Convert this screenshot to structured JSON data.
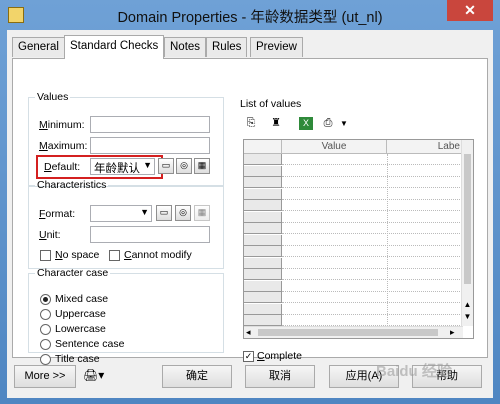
{
  "window": {
    "title": "Domain Properties - 年龄数据类型 (ut_nl)",
    "close": "✕"
  },
  "tabs": [
    {
      "label": "General"
    },
    {
      "label": "Standard Checks"
    },
    {
      "label": "Notes"
    },
    {
      "label": "Rules"
    },
    {
      "label": "Preview"
    }
  ],
  "values": {
    "legend": "Values",
    "minimum_label_ul": "M",
    "minimum_label": "inimum:",
    "maximum_label_ul": "M",
    "maximum_label": "aximum:",
    "default_label_ul": "D",
    "default_label": "efault:",
    "default_value": "年龄默认",
    "minimum_value": "",
    "maximum_value": ""
  },
  "characteristics": {
    "legend": "Characteristics",
    "format_label_ul": "F",
    "format_label": "ormat:",
    "unit_label_ul": "U",
    "unit_label": "nit:",
    "no_space_ul": "N",
    "no_space": "o space",
    "cannot_modify_ul": "C",
    "cannot_modify": "annot modify"
  },
  "character_case": {
    "legend": "Character case",
    "options": [
      {
        "label": "Mixed case",
        "selected": true
      },
      {
        "label": "Uppercase",
        "selected": false
      },
      {
        "label": "Lowercase",
        "selected": false
      },
      {
        "label": "Sentence case",
        "selected": false
      },
      {
        "label": "Title case",
        "selected": false
      }
    ]
  },
  "list_of_values": {
    "label": "List of values",
    "columns": [
      "Value",
      "Labe"
    ],
    "complete_label_ul": "C",
    "complete_label": "omplete",
    "complete_checked": true
  },
  "buttons": {
    "more": "More >>",
    "ok": "确定",
    "cancel": "取消",
    "apply": "应用(A)",
    "help": "帮助"
  },
  "watermark": "Baidu 经验",
  "colors": {
    "highlight": "#d42020",
    "title_bar": "#5b8fc7"
  }
}
